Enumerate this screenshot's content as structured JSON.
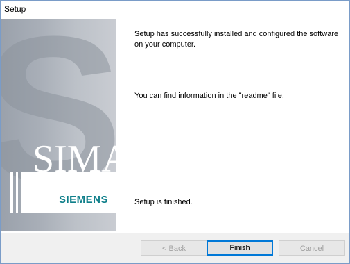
{
  "window": {
    "title": "Setup"
  },
  "banner": {
    "brand_watermark": "SIMA",
    "brand": "SIEMENS"
  },
  "messages": {
    "installed": "Setup has successfully installed and configured the software on your computer.",
    "readme": "You can find information in the \"readme\" file.",
    "finished": "Setup is finished."
  },
  "buttons": {
    "back": "< Back",
    "finish": "Finish",
    "cancel": "Cancel"
  },
  "colors": {
    "brand": "#0f7f8a",
    "default_button_border": "#0078d7"
  }
}
